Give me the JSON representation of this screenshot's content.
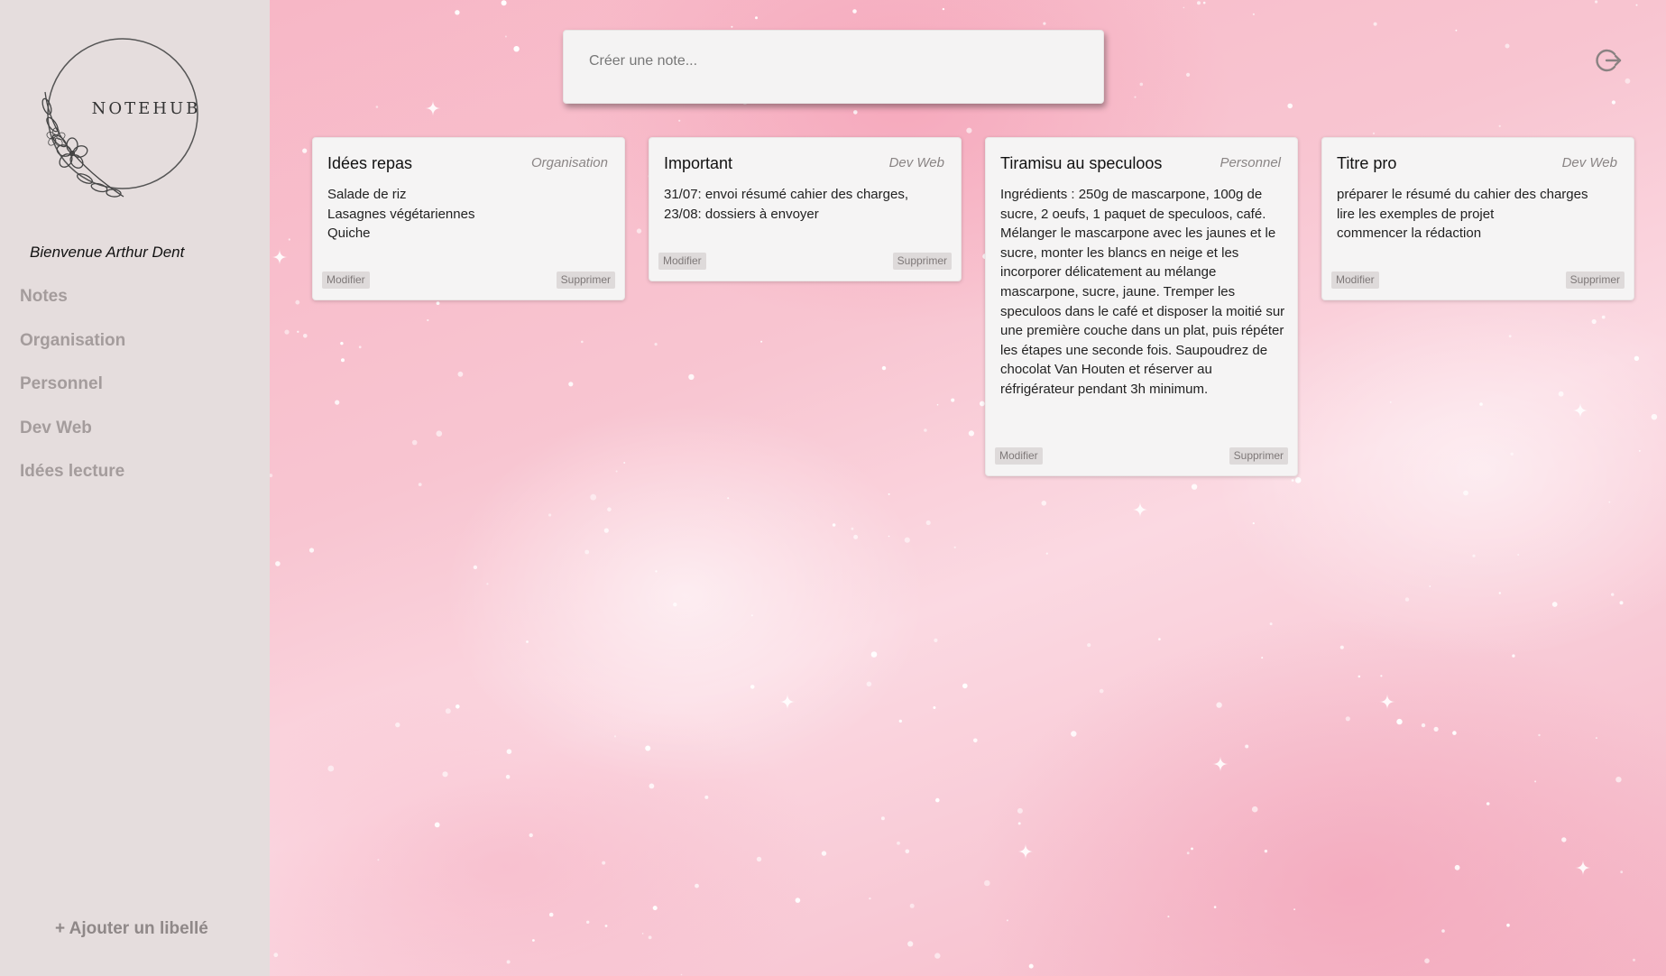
{
  "sidebar": {
    "logo_text": "NOTEHUB",
    "welcome": "Bienvenue Arthur Dent",
    "nav": [
      {
        "label": "Notes"
      },
      {
        "label": "Organisation"
      },
      {
        "label": "Personnel"
      },
      {
        "label": "Dev Web"
      },
      {
        "label": "Idées lecture"
      }
    ],
    "add_label": "+ Ajouter un libellé"
  },
  "create_note": {
    "placeholder": "Créer une note..."
  },
  "header": {
    "logout_icon": "logout-icon"
  },
  "notes": [
    {
      "title": "Idées repas",
      "label": "Organisation",
      "body": "Salade de riz\nLasagnes végétariennes\nQuiche",
      "edit_label": "Modifier",
      "delete_label": "Supprimer"
    },
    {
      "title": "Important",
      "label": "Dev Web",
      "body": "31/07: envoi résumé cahier des charges,\n23/08: dossiers à envoyer",
      "edit_label": "Modifier",
      "delete_label": "Supprimer"
    },
    {
      "title": "Tiramisu au speculoos",
      "label": "Personnel",
      "body": "Ingrédients : 250g de mascarpone, 100g de sucre, 2 oeufs, 1 paquet de speculoos, café. Mélanger le mascarpone avec les jaunes et le sucre, monter les blancs en neige et les incorporer délicatement au mélange mascarpone, sucre, jaune. Tremper les speculoos dans le café et disposer la moitié sur une première couche dans un plat, puis répéter les étapes une seconde fois. Saupoudrez de chocolat Van Houten et réserver au réfrigérateur pendant 3h minimum.",
      "edit_label": "Modifier",
      "delete_label": "Supprimer"
    },
    {
      "title": "Titre pro",
      "label": "Dev Web",
      "body": "préparer le résumé du cahier des charges\nlire les exemples de projet\ncommencer la rédaction",
      "edit_label": "Modifier",
      "delete_label": "Supprimer"
    }
  ],
  "colors": {
    "sidebar_bg": "#e5dddd",
    "page_bg": "#f7b4c4",
    "card_bg": "#f5f4f4",
    "nav_text": "#a49c9c"
  }
}
